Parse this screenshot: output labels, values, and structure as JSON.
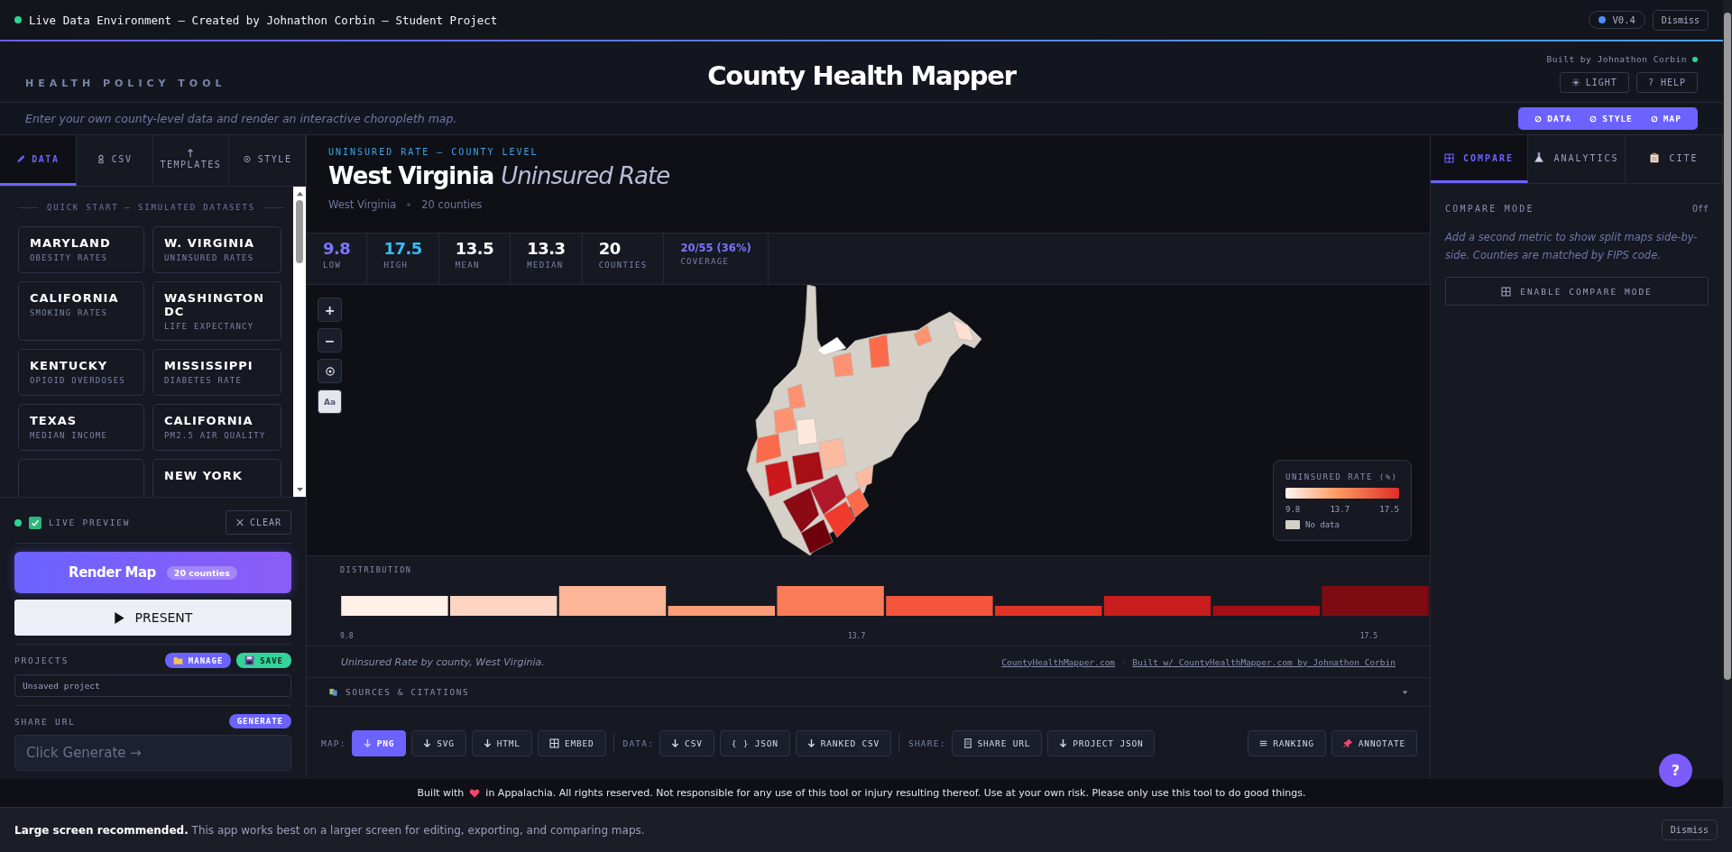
{
  "top_bar": {
    "status": "Live Data Environment — Created by Johnathon Corbin — Student Project",
    "version": "V0.4",
    "dismiss": "Dismiss"
  },
  "header": {
    "tagline": "HEALTH POLICY TOOL",
    "title": "County Health Mapper",
    "built_by": "Built by Johnathon Corbin",
    "light_button": "LIGHT",
    "help_button": "? HELP",
    "subtitle": "Enter your own county-level data and render an interactive choropleth map.",
    "jump_links": [
      "DATA",
      "STYLE",
      "MAP"
    ]
  },
  "left_panel": {
    "tabs": [
      {
        "label": "DATA",
        "selected": true
      },
      {
        "label": "CSV",
        "selected": false
      },
      {
        "label": "TEMPLATES",
        "selected": false
      },
      {
        "label": "STYLE",
        "selected": false
      }
    ],
    "quick_start_heading": "QUICK START — SIMULATED DATASETS",
    "datasets": [
      {
        "kind": "dataset",
        "title": "MARYLAND",
        "subtitle": "OBESITY RATES"
      },
      {
        "kind": "dataset",
        "title": "W. VIRGINIA",
        "subtitle": "UNINSURED RATES"
      },
      {
        "kind": "dataset",
        "title": "CALIFORNIA",
        "subtitle": "SMOKING RATES"
      },
      {
        "kind": "dataset",
        "title": "WASHINGTON DC",
        "subtitle": "LIFE EXPECTANCY"
      },
      {
        "kind": "dataset",
        "title": "KENTUCKY",
        "subtitle": "OPIOID OVERDOSES"
      },
      {
        "kind": "dataset",
        "title": "MISSISSIPPI",
        "subtitle": "DIABETES RATE"
      },
      {
        "kind": "dataset",
        "title": "TEXAS",
        "subtitle": "MEDIAN INCOME"
      },
      {
        "kind": "dataset",
        "title": "CALIFORNIA",
        "subtitle": "PM2.5 AIR QUALITY"
      },
      {
        "kind": "cut"
      },
      {
        "kind": "dataset",
        "title": "NEW YORK"
      }
    ],
    "live_preview": {
      "label": "LIVE PREVIEW",
      "checked": true
    },
    "clear_button": "CLEAR",
    "render_button": {
      "label": "Render Map",
      "badge": "20 counties"
    },
    "present_button": "PRESENT",
    "projects": {
      "label": "PROJECTS",
      "manage": "MANAGE",
      "save": "SAVE",
      "name": "Unsaved project"
    },
    "share": {
      "label": "SHARE URL",
      "generate": "GENERATE",
      "placeholder": "Click Generate →"
    }
  },
  "center": {
    "eyebrow": "UNINSURED RATE — COUNTY LEVEL",
    "title_state": "West Virginia",
    "title_metric": "Uninsured Rate",
    "meta": [
      "West Virginia",
      "20 counties"
    ],
    "stats": [
      {
        "kind": "low",
        "value": "9.8",
        "label": "LOW"
      },
      {
        "kind": "high",
        "value": "17.5",
        "label": "HIGH"
      },
      {
        "kind": "plain",
        "value": "13.5",
        "label": "MEAN"
      },
      {
        "kind": "plain",
        "value": "13.3",
        "label": "MEDIAN"
      },
      {
        "kind": "plain",
        "value": "20",
        "label": "COUNTIES"
      },
      {
        "kind": "coverage",
        "value": "20/55 (36%)",
        "label": "COVERAGE"
      }
    ],
    "map_controls": [
      {
        "kind": "text",
        "label": "+",
        "on": false
      },
      {
        "kind": "text",
        "label": "−",
        "on": false
      },
      {
        "kind": "target",
        "on": false
      },
      {
        "kind": "text",
        "label": "Aa",
        "on": true
      }
    ],
    "legend": {
      "title": "UNINSURED RATE (%)",
      "ticks": [
        "9.8",
        "13.7",
        "17.5"
      ],
      "no_data": "No data"
    },
    "distribution": {
      "title": "DISTRIBUTION",
      "ticks": [
        "9.8",
        "13.7",
        "17.5"
      ]
    },
    "caption": "Uninsured Rate by county, West Virginia.",
    "links": [
      "CountyHealthMapper.com",
      "Built w/ CountyHealthMapper.com by Johnathon Corbin"
    ],
    "link_separator": "·",
    "sources": {
      "label": "SOURCES & CITATIONS",
      "expanded": false
    },
    "toolbar": {
      "groups": [
        {
          "label": "MAP:",
          "buttons": [
            {
              "kind": "download",
              "label": "PNG",
              "selected": true
            },
            {
              "kind": "download",
              "label": "SVG",
              "selected": false
            },
            {
              "kind": "download",
              "label": "HTML",
              "selected": false
            },
            {
              "kind": "grid",
              "label": "EMBED",
              "selected": false
            }
          ]
        },
        {
          "label": "DATA:",
          "buttons": [
            {
              "kind": "download",
              "label": "CSV",
              "selected": false
            },
            {
              "kind": "plain",
              "label": "{ } JSON",
              "selected": false
            },
            {
              "kind": "download",
              "label": "RANKED CSV",
              "selected": false
            }
          ]
        },
        {
          "label": "SHARE:",
          "buttons": [
            {
              "kind": "clipboard",
              "label": "SHARE URL",
              "selected": false
            },
            {
              "kind": "download",
              "label": "PROJECT JSON",
              "selected": false
            }
          ]
        }
      ],
      "right_buttons": [
        {
          "kind": "list",
          "label": "RANKING"
        },
        {
          "kind": "pin",
          "label": "ANNOTATE"
        }
      ]
    }
  },
  "right_panel": {
    "tabs": [
      {
        "label": "COMPARE",
        "selected": true
      },
      {
        "label": "ANALYTICS",
        "selected": false
      },
      {
        "label": "CITE",
        "selected": false
      }
    ],
    "compare_label": "COMPARE MODE",
    "compare_state": "Off",
    "description": "Add a second metric to show split maps side-by-side. Counties are matched by FIPS code.",
    "enable_button": "ENABLE COMPARE MODE"
  },
  "footer": {
    "before": "Built with",
    "after": "in Appalachia. All rights reserved. Not responsible for any use of this tool or injury resulting thereof. Use at your own risk. Please only use this tool to do good things."
  },
  "banner": {
    "text": "**Large screen recommended.** This app works best on a larger screen for editing, exporting, and comparing maps.",
    "dismiss": "Dismiss"
  },
  "help_fab": "?"
}
